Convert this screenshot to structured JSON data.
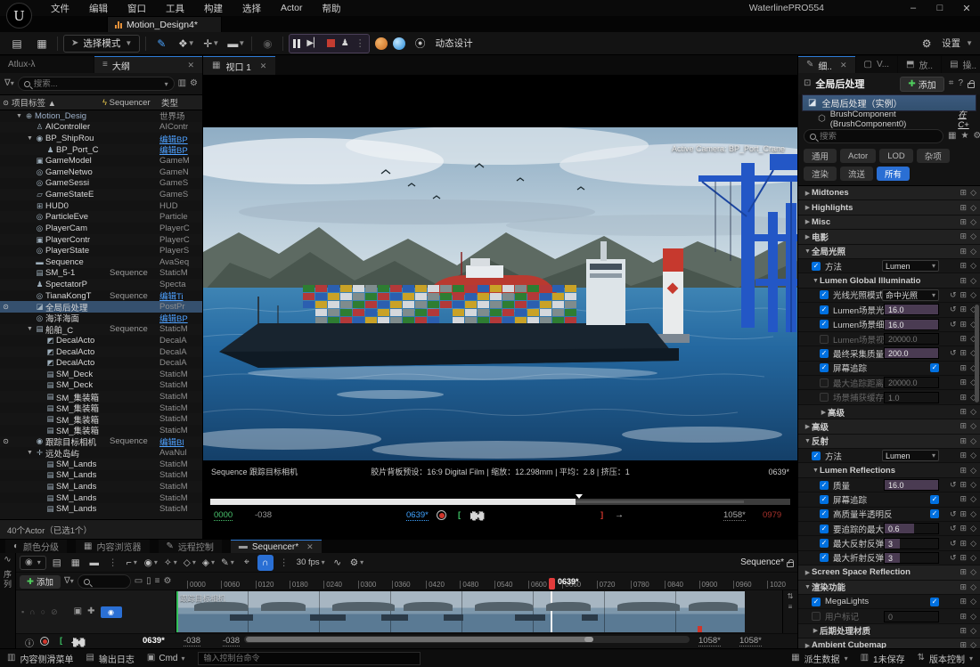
{
  "window": {
    "title": "WaterlinePRO554",
    "logo": "U",
    "menus": [
      "文件",
      "编辑",
      "窗口",
      "工具",
      "构建",
      "选择",
      "Actor",
      "帮助"
    ],
    "min": "–",
    "max": "□",
    "close": "✕"
  },
  "asset_tab": {
    "label": "Motion_Design4*"
  },
  "toolbar": {
    "select_mode": "选择模式",
    "motion_design_label": "动态设计",
    "settings_label": "设置"
  },
  "outliner": {
    "tab_left": "Atlux-λ",
    "tab_main": "大纲",
    "search_placeholder": "搜索...",
    "columns": {
      "label": "项目标签",
      "sequencer": "Sequencer",
      "type": "类型"
    },
    "footer": "40个Actor（已选1个）",
    "rows": [
      {
        "name": "Motion_Desig",
        "type": "世界场",
        "depth": 0,
        "icon": "world",
        "arrow": true,
        "sel2": true
      },
      {
        "name": "AIController",
        "type": "AIContr",
        "depth": 1,
        "icon": "pawn"
      },
      {
        "name": "BP_ShipRou",
        "type": "编辑BP",
        "depth": 1,
        "icon": "camera",
        "arrow": true,
        "link": true
      },
      {
        "name": "BP_Port_C",
        "type": "编辑BP",
        "depth": 2,
        "icon": "pole",
        "link": true
      },
      {
        "name": "GameModel",
        "type": "GameM",
        "depth": 1,
        "icon": "pad"
      },
      {
        "name": "GameNetwo",
        "type": "GameN",
        "depth": 1,
        "icon": "class"
      },
      {
        "name": "GameSessi",
        "type": "GameS",
        "depth": 1,
        "icon": "class"
      },
      {
        "name": "GameStateE",
        "type": "GameS",
        "depth": 1,
        "icon": "chart"
      },
      {
        "name": "HUD0",
        "type": "HUD",
        "depth": 1,
        "icon": "hud"
      },
      {
        "name": "ParticleEve",
        "type": "Particle",
        "depth": 1,
        "icon": "class"
      },
      {
        "name": "PlayerCam",
        "type": "PlayerC",
        "depth": 1,
        "icon": "class"
      },
      {
        "name": "PlayerContr",
        "type": "PlayerC",
        "depth": 1,
        "icon": "pad"
      },
      {
        "name": "PlayerState",
        "type": "PlayerS",
        "depth": 1,
        "icon": "class"
      },
      {
        "name": "Sequence",
        "type": "AvaSeq",
        "depth": 1,
        "icon": "clapper"
      },
      {
        "name": "SM_5-1",
        "seq": "Sequence",
        "type": "StaticM",
        "depth": 1,
        "icon": "mesh"
      },
      {
        "name": "SpectatorP",
        "type": "Specta",
        "depth": 1,
        "icon": "spectator"
      },
      {
        "name": "TianaKongT",
        "seq": "Sequence",
        "type": "编辑Ti",
        "depth": 1,
        "icon": "class",
        "link": true
      },
      {
        "name": "全局后处理",
        "type": "PostPr",
        "depth": 1,
        "icon": "postfx",
        "selected": true,
        "eye": true
      },
      {
        "name": "海洋海面",
        "type": "编辑BP",
        "depth": 1,
        "icon": "class",
        "link": true
      },
      {
        "name": "船舶_C",
        "seq": "Sequence",
        "type": "StaticM",
        "depth": 1,
        "icon": "mesh",
        "arrow": true
      },
      {
        "name": "DecalActo",
        "type": "DecalA",
        "depth": 2,
        "icon": "decal"
      },
      {
        "name": "DecalActo",
        "type": "DecalA",
        "depth": 2,
        "icon": "decal"
      },
      {
        "name": "DecalActo",
        "type": "DecalA",
        "depth": 2,
        "icon": "decal"
      },
      {
        "name": "SM_Deck",
        "type": "StaticM",
        "depth": 2,
        "icon": "mesh"
      },
      {
        "name": "SM_Deck",
        "type": "StaticM",
        "depth": 2,
        "icon": "mesh"
      },
      {
        "name": "SM_集装箱",
        "type": "StaticM",
        "depth": 2,
        "icon": "mesh"
      },
      {
        "name": "SM_集装箱",
        "type": "StaticM",
        "depth": 2,
        "icon": "mesh"
      },
      {
        "name": "SM_集装箱",
        "type": "StaticM",
        "depth": 2,
        "icon": "mesh"
      },
      {
        "name": "SM_集装箱",
        "type": "StaticM",
        "depth": 2,
        "icon": "mesh"
      },
      {
        "name": "跟踪目标相机",
        "seq": "Sequence",
        "type": "编辑Bl",
        "depth": 1,
        "icon": "camera",
        "link": true,
        "eye": true
      },
      {
        "name": "远处岛屿",
        "type": "AvaNul",
        "depth": 1,
        "icon": "move",
        "arrow": true
      },
      {
        "name": "SM_Lands",
        "type": "StaticM",
        "depth": 2,
        "icon": "mesh"
      },
      {
        "name": "SM_Lands",
        "type": "StaticM",
        "depth": 2,
        "icon": "mesh"
      },
      {
        "name": "SM_Lands",
        "type": "StaticM",
        "depth": 2,
        "icon": "mesh"
      },
      {
        "name": "SM_Lands",
        "type": "StaticM",
        "depth": 2,
        "icon": "mesh"
      },
      {
        "name": "SM_Lands",
        "type": "StaticM",
        "depth": 2,
        "icon": "mesh"
      }
    ]
  },
  "viewport": {
    "tab": "视口 1",
    "active_camera": "Active Camera: BP_Port_Crane",
    "camera_bar": {
      "left": "Sequence 跟踪目标相机",
      "center": "胶片背板预设：16:9 Digital Film | 缩放：12.298mm | 平均：2.8 | 挤压：1",
      "right": "0639*"
    },
    "transport": {
      "start": "0000",
      "offset": "-038",
      "current": "0639*",
      "end": "1058*",
      "total": "0979"
    }
  },
  "details": {
    "tabs": [
      {
        "label": "细..",
        "active": true
      },
      {
        "label": "V..."
      },
      {
        "label": "放.."
      },
      {
        "label": "操.."
      }
    ],
    "title": "全局后处理",
    "add_label": "添加",
    "instance_label": "全局后处理（实例）",
    "component_label": "BrushComponent (BrushComponent0)",
    "component_link": "在C+",
    "search_placeholder": "搜索",
    "chips": [
      {
        "label": "通用"
      },
      {
        "label": "Actor"
      },
      {
        "label": "LOD"
      },
      {
        "label": "杂项"
      },
      {
        "label": "渲染"
      },
      {
        "label": "流送"
      },
      {
        "label": "所有",
        "on": true
      }
    ],
    "rows": [
      {
        "t": "sec",
        "label": "Midtones",
        "open": false,
        "level": 0
      },
      {
        "t": "sec",
        "label": "Highlights",
        "open": false,
        "level": 0
      },
      {
        "t": "sec",
        "label": "Misc",
        "open": false,
        "level": 0
      },
      {
        "t": "sec",
        "label": "电影",
        "open": false,
        "level": 0
      },
      {
        "t": "sec",
        "label": "全局光照",
        "open": true,
        "level": 0
      },
      {
        "t": "prop",
        "label": "方法",
        "cb": true,
        "ctl": "dropdown",
        "value": "Lumen",
        "level": 1
      },
      {
        "t": "sec",
        "label": "Lumen Global Illuminatio",
        "open": true,
        "level": 1
      },
      {
        "t": "prop",
        "label": "光线光照模式",
        "cb": true,
        "ctl": "dropdown",
        "value": "命中光照",
        "reset": true,
        "level": 2
      },
      {
        "t": "prop",
        "label": "Lumen场景光照",
        "cb": true,
        "ctl": "value",
        "value": "16.0",
        "fill": 100,
        "reset": true,
        "level": 2
      },
      {
        "t": "prop",
        "label": "Lumen场景细节",
        "cb": true,
        "ctl": "value",
        "value": "16.0",
        "fill": 100,
        "reset": true,
        "level": 2
      },
      {
        "t": "prop",
        "label": "Lumen场景视野",
        "cb": false,
        "ctl": "value",
        "value": "20000.0",
        "fill": 0,
        "dim": true,
        "level": 2
      },
      {
        "t": "prop",
        "label": "最终采集质量",
        "cb": true,
        "ctl": "value",
        "value": "200.0",
        "fill": 100,
        "reset": true,
        "level": 2
      },
      {
        "t": "prop",
        "label": "屏幕追踪",
        "cb": true,
        "ctl": "check",
        "level": 2
      },
      {
        "t": "prop",
        "label": "最大追踪距离",
        "cb": false,
        "ctl": "value",
        "value": "20000.0",
        "fill": 0,
        "dim": true,
        "level": 2
      },
      {
        "t": "prop",
        "label": "场景捕获缓存分",
        "cb": false,
        "ctl": "value",
        "value": "1.0",
        "fill": 0,
        "dim": true,
        "level": 2
      },
      {
        "t": "sec",
        "label": "高级",
        "open": false,
        "level": 2
      },
      {
        "t": "sec",
        "label": "高级",
        "open": false,
        "level": 0
      },
      {
        "t": "sec",
        "label": "反射",
        "open": true,
        "level": 0
      },
      {
        "t": "prop",
        "label": "方法",
        "cb": true,
        "ctl": "dropdown",
        "value": "Lumen",
        "level": 1
      },
      {
        "t": "sec",
        "label": "Lumen Reflections",
        "open": true,
        "level": 1
      },
      {
        "t": "prop",
        "label": "质量",
        "cb": true,
        "ctl": "value",
        "value": "16.0",
        "fill": 100,
        "reset": true,
        "level": 2
      },
      {
        "t": "prop",
        "label": "屏幕追踪",
        "cb": true,
        "ctl": "check",
        "level": 2
      },
      {
        "t": "prop",
        "label": "高质量半透明反",
        "cb": true,
        "ctl": "check",
        "reset": true,
        "level": 2
      },
      {
        "t": "prop",
        "label": "要追踪的最大粗",
        "cb": true,
        "ctl": "value",
        "value": "0.6",
        "fill": 55,
        "reset": true,
        "level": 2
      },
      {
        "t": "prop",
        "label": "最大反射反弹",
        "cb": true,
        "ctl": "value",
        "value": "3",
        "fill": 28,
        "reset": true,
        "level": 2
      },
      {
        "t": "prop",
        "label": "最大折射反弹次",
        "cb": true,
        "ctl": "value",
        "value": "3",
        "fill": 28,
        "reset": true,
        "level": 2
      },
      {
        "t": "sec",
        "label": "Screen Space Reflection",
        "open": false,
        "level": 0
      },
      {
        "t": "sec",
        "label": "渲染功能",
        "open": true,
        "level": 0
      },
      {
        "t": "prop",
        "label": "MegaLights",
        "cb": true,
        "ctl": "check",
        "level": 1
      },
      {
        "t": "prop",
        "label": "用户标记",
        "cb": false,
        "ctl": "value",
        "value": "0",
        "fill": 0,
        "dim": true,
        "level": 1
      },
      {
        "t": "sec",
        "label": "后期处理材质",
        "open": false,
        "level": 1
      },
      {
        "t": "sec",
        "label": "Ambient Cubemap",
        "open": false,
        "level": 0
      }
    ]
  },
  "sequencer": {
    "panel_tabs": [
      {
        "label": "颜色分级"
      },
      {
        "label": "内容浏览器"
      },
      {
        "label": "远程控制"
      },
      {
        "label": "Sequencer*",
        "active": true
      }
    ],
    "fps": "30 fps",
    "sequence_label": "Sequence*",
    "add_label": "添加",
    "vertical_label": "序列",
    "ruler": [
      "0000",
      "0060",
      "0120",
      "0180",
      "0240",
      "0300",
      "0360",
      "0420",
      "0480",
      "0540",
      "0600",
      "0660",
      "0720",
      "0780",
      "0840",
      "0900",
      "0960",
      "1020"
    ],
    "playhead": "0639*",
    "track_label": "跟踪目标相机",
    "transport": {
      "current": "0639*",
      "a": "-038",
      "b": "-038",
      "end1": "1058*",
      "end2": "1058*"
    }
  },
  "statusbar": {
    "content_drawer": "内容侧滑菜单",
    "output_log": "输出日志",
    "cmd": "Cmd",
    "console_placeholder": "输入控制台命令",
    "derived_data": "派生数据",
    "unsaved": "1未保存",
    "revision": "版本控制"
  }
}
